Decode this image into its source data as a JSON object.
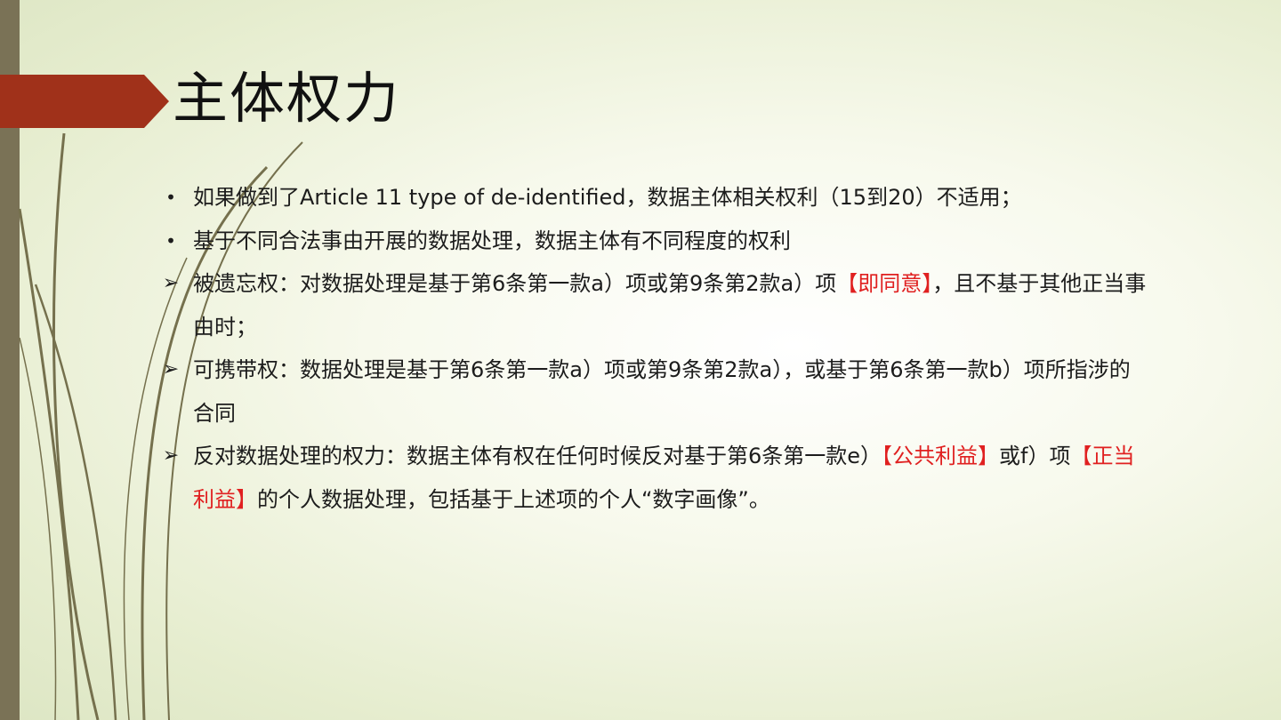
{
  "slide": {
    "title": "主体权力",
    "colors": {
      "accent_arrow": "#a0311a",
      "sidebar": "#7a7256",
      "highlight": "#e02020",
      "decor_lines": "#75704d"
    },
    "items": [
      {
        "marker": "•",
        "marker_type": "bullet",
        "parts": [
          "如果做到了Article 11 type of de-identified，数据主体相关权利（15到20）不适用；"
        ]
      },
      {
        "marker": "•",
        "marker_type": "bullet",
        "parts": [
          "基于不同合法事由开展的数据处理，数据主体有不同程度的权利"
        ]
      },
      {
        "marker": "➢",
        "marker_type": "arrow",
        "parts": [
          "被遗忘权：对数据处理是基于第6条第一款a）项或第9条第2款a）项",
          "【即同意】",
          "，且不基于其他正当事由时；"
        ]
      },
      {
        "marker": "➢",
        "marker_type": "arrow",
        "parts": [
          "可携带权：数据处理是基于第6条第一款a）项或第9条第2款a），或基于第6条第一款b）项所指涉的合同"
        ]
      },
      {
        "marker": "➢",
        "marker_type": "arrow",
        "parts": [
          "反对数据处理的权力：数据主体有权在任何时候反对基于第6条第一款e）",
          "【公共利益】",
          "或f）项",
          "【正当利益】",
          "的个人数据处理，包括基于上述项的个人“数字画像”。"
        ]
      }
    ]
  }
}
